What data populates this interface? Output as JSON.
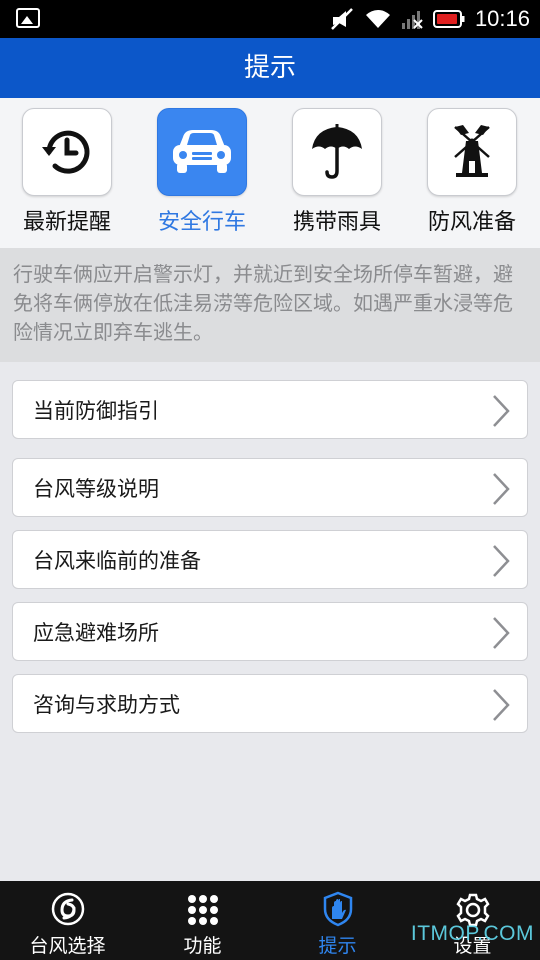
{
  "status_bar": {
    "time": "10:16"
  },
  "header": {
    "title": "提示"
  },
  "tabs": [
    {
      "label": "最新提醒",
      "icon": "history-clock-icon",
      "active": false
    },
    {
      "label": "安全行车",
      "icon": "car-icon",
      "active": true
    },
    {
      "label": "携带雨具",
      "icon": "umbrella-icon",
      "active": false
    },
    {
      "label": "防风准备",
      "icon": "windmill-icon",
      "active": false
    }
  ],
  "tip": {
    "text": "行驶车俩应开启警示灯，并就近到安全场所停车暂避，避免将车俩停放在低洼易涝等危险区域。如遇严重水浸等危险情况立即弃车逃生。"
  },
  "menu": [
    {
      "label": "当前防御指引"
    },
    {
      "label": "台风等级说明"
    },
    {
      "label": "台风来临前的准备"
    },
    {
      "label": "应急避难场所"
    },
    {
      "label": "咨询与求助方式"
    }
  ],
  "bottom_nav": [
    {
      "label": "台风选择",
      "icon": "typhoon-icon",
      "active": false
    },
    {
      "label": "功能",
      "icon": "grid-icon",
      "active": false
    },
    {
      "label": "提示",
      "icon": "shield-hand-icon",
      "active": true
    },
    {
      "label": "设置",
      "icon": "gear-icon",
      "active": false
    }
  ],
  "watermark": "ITMOP.COM",
  "colors": {
    "header": "#0c57c9",
    "accent": "#3a86f0",
    "bottom_bar": "#141414"
  }
}
